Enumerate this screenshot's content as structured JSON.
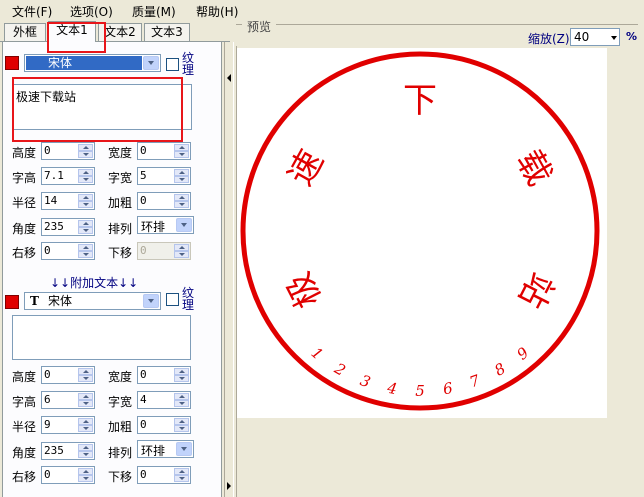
{
  "menu": [
    {
      "label": "文件(F)"
    },
    {
      "label": "选项(O)"
    },
    {
      "label": "质量(M)"
    },
    {
      "label": "帮助(H)"
    }
  ],
  "tabs": [
    {
      "label": "外框"
    },
    {
      "label": "文本1"
    },
    {
      "label": "文本2"
    },
    {
      "label": "文本3"
    }
  ],
  "text1": {
    "color": "#e00000",
    "font": "宋体",
    "texture_label": "纹理",
    "content": "极速下载站",
    "height_label": "高度",
    "height": "0",
    "width_label": "宽度",
    "width": "0",
    "char_height_label": "字高",
    "char_height": "7.1",
    "char_width_label": "字宽",
    "char_width": "5",
    "radius_label": "半径",
    "radius": "14",
    "bold_label": "加粗",
    "bold": "0",
    "angle_label": "角度",
    "angle": "235",
    "arrange_label": "排列",
    "arrange": "环排",
    "right_label": "右移",
    "right": "0",
    "down_label": "下移",
    "down": "0"
  },
  "additional_text_heading": "↓↓附加文本↓↓",
  "extra": {
    "color": "#e00000",
    "font": "宋体",
    "texture_label": "纹理",
    "content": "",
    "height_label": "高度",
    "height": "0",
    "width_label": "宽度",
    "width": "0",
    "char_height_label": "字高",
    "char_height": "6",
    "char_width_label": "字宽",
    "char_width": "4",
    "radius_label": "半径",
    "radius": "9",
    "bold_label": "加粗",
    "bold": "0",
    "angle_label": "角度",
    "angle": "235",
    "arrange_label": "排列",
    "arrange": "环排",
    "right_label": "右移",
    "right": "0",
    "down_label": "下移",
    "down": "0"
  },
  "preview": {
    "label": "预览",
    "zoom_label": "缩放(Z)",
    "zoom_value": "40",
    "zoom_unit": "%"
  },
  "stamp": {
    "color": "#e00000",
    "chars": [
      "极",
      "速",
      "下",
      "载",
      "站"
    ],
    "numbers": [
      "1",
      "2",
      "3",
      "4",
      "5",
      "6",
      "7",
      "8",
      "9"
    ]
  }
}
